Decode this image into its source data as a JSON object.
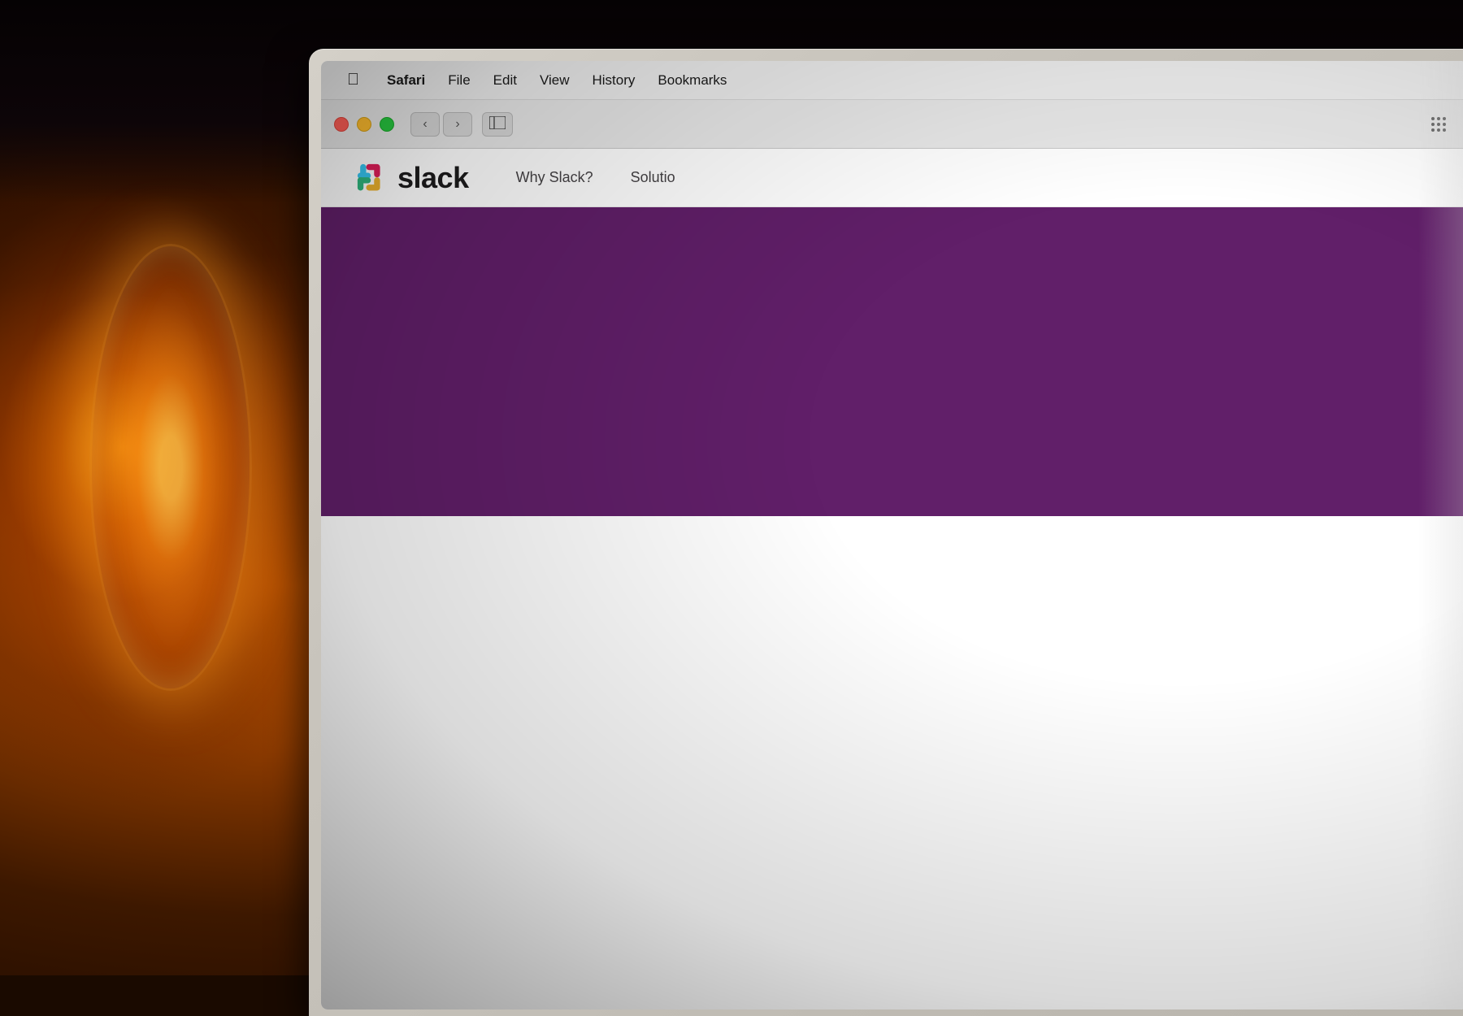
{
  "background": {
    "description": "Dark warm background with glowing lamp"
  },
  "menubar": {
    "apple_symbol": "🍎",
    "items": [
      {
        "id": "apple",
        "label": "⌘",
        "bold": false,
        "is_apple": true
      },
      {
        "id": "safari",
        "label": "Safari",
        "bold": true
      },
      {
        "id": "file",
        "label": "File",
        "bold": false
      },
      {
        "id": "edit",
        "label": "Edit",
        "bold": false
      },
      {
        "id": "view",
        "label": "View",
        "bold": false
      },
      {
        "id": "history",
        "label": "History",
        "bold": false
      },
      {
        "id": "bookmarks",
        "label": "Bookmarks",
        "bold": false
      }
    ]
  },
  "browser": {
    "back_btn": "‹",
    "forward_btn": "›",
    "sidebar_icon": "⊡",
    "grid_icon": "⠿"
  },
  "slack_nav": {
    "wordmark": "slack",
    "nav_items": [
      {
        "id": "why-slack",
        "label": "Why Slack?"
      },
      {
        "id": "solutions",
        "label": "Solutio"
      }
    ]
  },
  "traffic_lights": {
    "close_color": "#ff5f57",
    "minimize_color": "#febc2e",
    "maximize_color": "#28c840"
  },
  "slack_hero": {
    "background_color": "#611f69"
  }
}
